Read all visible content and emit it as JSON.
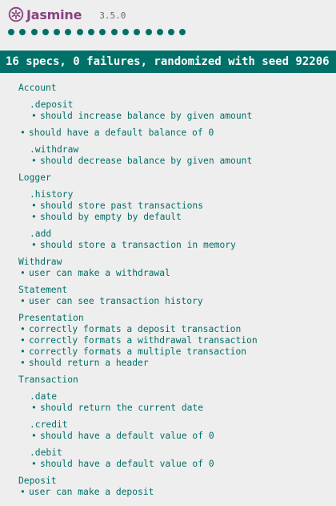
{
  "header": {
    "brand": "Jasmine",
    "version": "3.5.0"
  },
  "summary": {
    "text": "16 specs, 0 failures, randomized with seed 92206",
    "dot_count": 16
  },
  "colors": {
    "passed": "#007069",
    "brand": "#8a4182",
    "background": "#eeeeee"
  },
  "suites": {
    "account": {
      "title": "Account",
      "deposit": {
        "title": ".deposit",
        "specs": [
          "should increase balance by given amount"
        ]
      },
      "spec_default": "should have a default balance of 0",
      "withdraw": {
        "title": ".withdraw",
        "specs": [
          "should decrease balance by given amount"
        ]
      }
    },
    "logger": {
      "title": "Logger",
      "history": {
        "title": ".history",
        "specs": [
          "should store past transactions",
          "should by empty by default"
        ]
      },
      "add": {
        "title": ".add",
        "specs": [
          "should store a transaction in memory"
        ]
      }
    },
    "withdraw": {
      "title": "Withdraw",
      "specs": [
        "user can make a withdrawal"
      ]
    },
    "statement": {
      "title": "Statement",
      "specs": [
        "user can see transaction history"
      ]
    },
    "presentation": {
      "title": "Presentation",
      "specs": [
        "correctly formats a deposit transaction",
        "correctly formats a withdrawal transaction",
        "correctly formats a multiple transaction",
        "should return a header"
      ]
    },
    "transaction": {
      "title": "Transaction",
      "date": {
        "title": ".date",
        "specs": [
          "should return the current date"
        ]
      },
      "credit": {
        "title": ".credit",
        "specs": [
          "should have a default value of 0"
        ]
      },
      "debit": {
        "title": ".debit",
        "specs": [
          "should have a default value of 0"
        ]
      }
    },
    "deposit": {
      "title": "Deposit",
      "specs": [
        "user can make a deposit"
      ]
    }
  }
}
